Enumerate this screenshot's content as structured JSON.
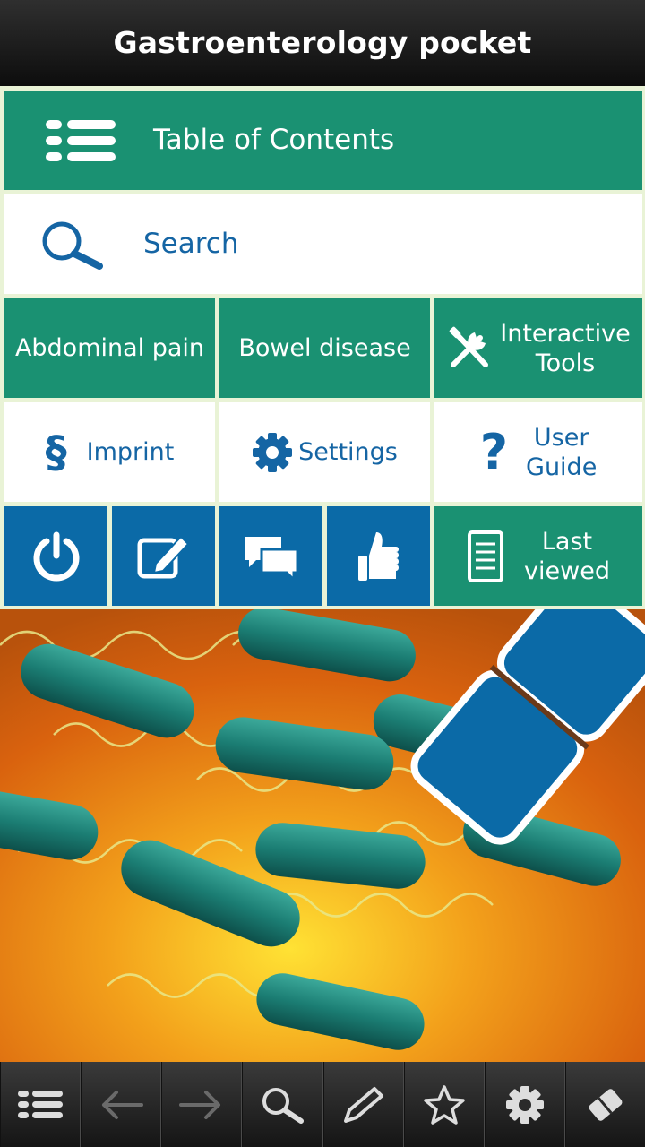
{
  "app": {
    "title": "Gastroenterology pocket"
  },
  "menu": {
    "toc_label": "Table of Contents",
    "search_label": "Search",
    "abdominal_label": "Abdominal pain",
    "bowel_label": "Bowel disease",
    "tools_line1": "Interactive",
    "tools_line2": "Tools",
    "imprint_label": "Imprint",
    "settings_label": "Settings",
    "guide_line1": "User",
    "guide_line2": "Guide",
    "last_line1": "Last",
    "last_line2": "viewed"
  },
  "icons": {
    "toc": "list-icon",
    "search": "search-icon",
    "tools": "tools-icon",
    "imprint": "section-sign-icon",
    "settings": "gear-icon",
    "guide": "question-icon",
    "power": "power-icon",
    "note": "edit-note-icon",
    "chat": "chat-icon",
    "like": "thumbs-up-icon",
    "last": "document-icon"
  },
  "bottom_bar": [
    "menu-icon",
    "back-arrow-icon",
    "forward-arrow-icon",
    "search-icon",
    "pencil-icon",
    "star-icon",
    "gear-icon",
    "eraser-icon"
  ],
  "colors": {
    "green": "#1a9172",
    "blue": "#0b6aa7",
    "text_blue": "#1565a4",
    "background": "#e9f3d6"
  }
}
